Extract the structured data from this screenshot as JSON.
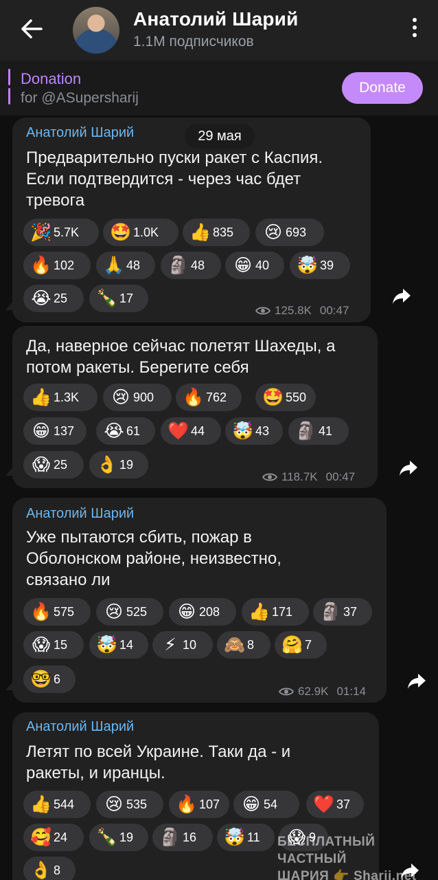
{
  "header": {
    "title": "Анатолий Шарий",
    "subtitle": "1.1M подписчиков"
  },
  "pinned": {
    "title": "Donation",
    "subtitle": "for @ASupersharij",
    "button": "Donate"
  },
  "date_chip": "29 мая",
  "posts": [
    {
      "author": "Анатолий Шарий",
      "lines": [
        "Предварительно пуски ракет с Каспия.",
        "Если подтвердится - через час бдет",
        "тревога"
      ],
      "reactions": [
        {
          "emoji": "🎉",
          "count": "5.7K"
        },
        {
          "emoji": "🤩",
          "count": "1.0K"
        },
        {
          "emoji": "👍",
          "count": "835"
        },
        {
          "emoji": "😢",
          "count": "693"
        },
        {
          "emoji": "🔥",
          "count": "102"
        },
        {
          "emoji": "🙏",
          "count": "48"
        },
        {
          "emoji": "🗿",
          "count": "48"
        },
        {
          "emoji": "😁",
          "count": "40"
        },
        {
          "emoji": "🤯",
          "count": "39"
        },
        {
          "emoji": "😭",
          "count": "25"
        },
        {
          "emoji": "🍾",
          "count": "17"
        }
      ],
      "views": "125.8K",
      "time": "00:47"
    },
    {
      "author": "",
      "lines": [
        "Да, наверное сейчас полетят Шахеды, а",
        "потом ракеты. Берегите себя"
      ],
      "reactions": [
        {
          "emoji": "👍",
          "count": "1.3K"
        },
        {
          "emoji": "😢",
          "count": "900"
        },
        {
          "emoji": "🔥",
          "count": "762"
        },
        {
          "emoji": "🤩",
          "count": "550"
        },
        {
          "emoji": "😁",
          "count": "137"
        },
        {
          "emoji": "😭",
          "count": "61"
        },
        {
          "emoji": "❤️",
          "count": "44"
        },
        {
          "emoji": "🤯",
          "count": "43"
        },
        {
          "emoji": "🗿",
          "count": "41"
        },
        {
          "emoji": "😱",
          "count": "25"
        },
        {
          "emoji": "👌",
          "count": "19"
        }
      ],
      "views": "118.7K",
      "time": "00:47"
    },
    {
      "author": "Анатолий Шарий",
      "lines": [
        "Уже пытаются сбить, пожар в",
        "Оболонском районе, неизвестно,",
        "связано ли"
      ],
      "reactions": [
        {
          "emoji": "🔥",
          "count": "575"
        },
        {
          "emoji": "😢",
          "count": "525"
        },
        {
          "emoji": "😁",
          "count": "208"
        },
        {
          "emoji": "👍",
          "count": "171"
        },
        {
          "emoji": "🗿",
          "count": "37"
        },
        {
          "emoji": "😱",
          "count": "15"
        },
        {
          "emoji": "🤯",
          "count": "14"
        },
        {
          "emoji": "⚡",
          "count": "10"
        },
        {
          "emoji": "🙈",
          "count": "8"
        },
        {
          "emoji": "🤗",
          "count": "7"
        },
        {
          "emoji": "🤓",
          "count": "6"
        }
      ],
      "views": "62.9K",
      "time": "01:14"
    },
    {
      "author": "Анатолий Шарий",
      "lines": [
        "Летят по всей Украине. Таки да - и",
        "ракеты, и иранцы."
      ],
      "reactions": [
        {
          "emoji": "👍",
          "count": "544"
        },
        {
          "emoji": "😢",
          "count": "535"
        },
        {
          "emoji": "🔥",
          "count": "107"
        },
        {
          "emoji": "😁",
          "count": "54"
        },
        {
          "emoji": "❤️",
          "count": "37"
        },
        {
          "emoji": "🥰",
          "count": "24"
        },
        {
          "emoji": "🍾",
          "count": "19"
        },
        {
          "emoji": "🗿",
          "count": "16"
        },
        {
          "emoji": "🤯",
          "count": "11"
        },
        {
          "emoji": "😱",
          "count": "9"
        },
        {
          "emoji": "👌",
          "count": "8"
        }
      ],
      "views": "",
      "time": ""
    }
  ],
  "watermark": [
    "БЕСПЛАТНЫЙ ЧАСТНЫЙ",
    "ШАРИЯ 👉 Sharij.net"
  ]
}
